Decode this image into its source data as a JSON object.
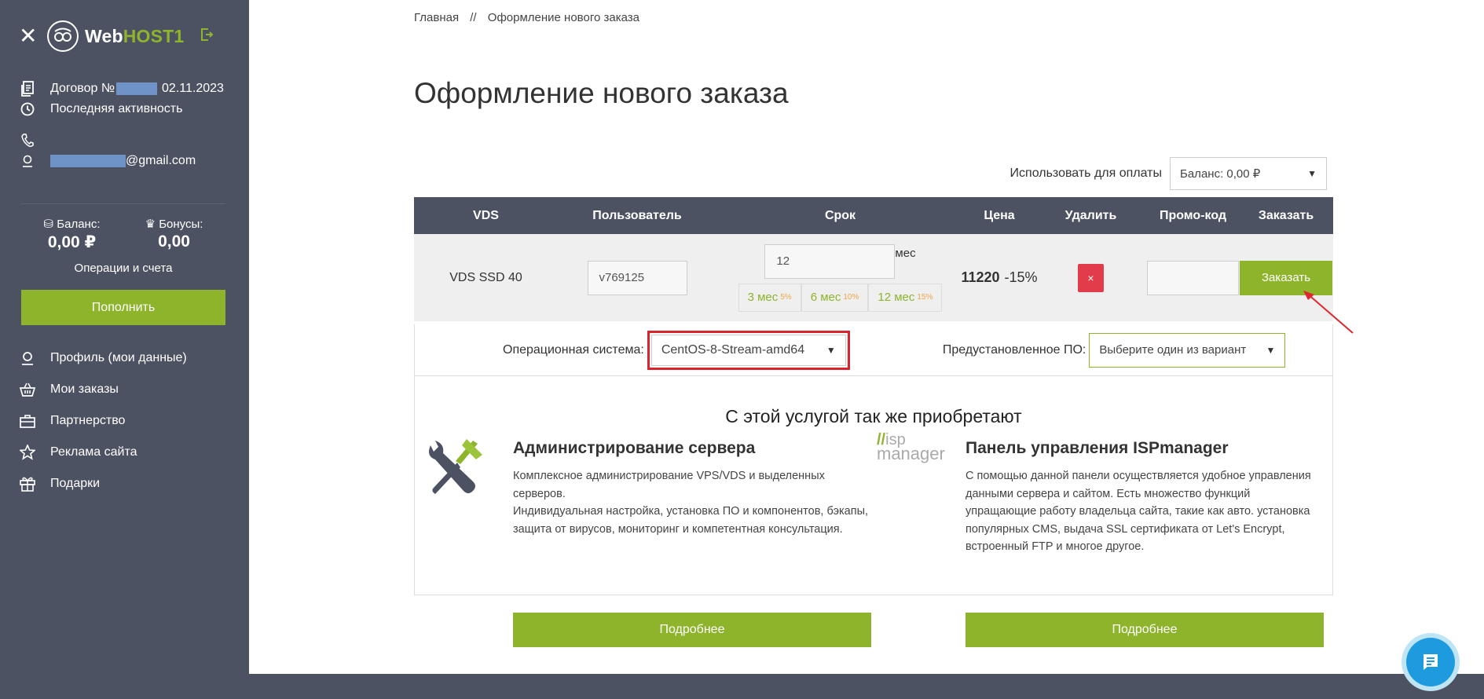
{
  "sidebar": {
    "logo_web": "Web",
    "logo_host": "HOST1",
    "contract_prefix": "Договор №",
    "contract_date": "02.11.2023",
    "last_activity": "Последняя активность",
    "email_suffix": "@gmail.com",
    "balance_label": "Баланс:",
    "balance_value": "0,00 ₽",
    "bonus_label": "Бонусы:",
    "bonus_value": "0,00",
    "operations_link": "Операции и счета",
    "topup_button": "Пополнить",
    "menu": [
      {
        "label": "Профиль (мои данные)",
        "icon": "user-icon"
      },
      {
        "label": "Мои заказы",
        "icon": "basket-icon"
      },
      {
        "label": "Партнерство",
        "icon": "briefcase-icon"
      },
      {
        "label": "Реклама сайта",
        "icon": "star-icon"
      },
      {
        "label": "Подарки",
        "icon": "gift-icon"
      }
    ]
  },
  "breadcrumb": {
    "home": "Главная",
    "separator": "//",
    "current": "Оформление нового заказа"
  },
  "page_title": "Оформление нового заказа",
  "payment": {
    "label": "Использовать для оплаты",
    "selected": "Баланс: 0,00 ₽"
  },
  "table": {
    "headers": [
      "VDS",
      "Пользователь",
      "Срок",
      "Цена",
      "Удалить",
      "Промо-код",
      "Заказать"
    ],
    "row": {
      "vds": "VDS SSD 40",
      "user": "v769125",
      "term_value": "12",
      "term_unit": "мес",
      "presets": [
        {
          "label": "3 мес",
          "discount": "5%"
        },
        {
          "label": "6 мес",
          "discount": "10%"
        },
        {
          "label": "12 мес",
          "discount": "15%"
        }
      ],
      "price": "11220",
      "discount": "-15%",
      "delete_symbol": "×",
      "promo": "",
      "order_button": "Заказать"
    }
  },
  "os": {
    "label": "Операционная система:",
    "selected": "CentOS-8-Stream-amd64",
    "software_label": "Предустановленное ПО:",
    "software_selected": "Выберите один из вариант"
  },
  "upsell": {
    "title": "С этой услугой так же приобретают",
    "cards": [
      {
        "title": "Администрирование сервера",
        "text1": "Комплексное администрирование VPS/VDS и выделенных серверов.",
        "text2": "Индивидуальная настройка, установка ПО и компонентов, бэкапы, защита от вирусов, мониторинг и компетентная консультация.",
        "button": "Подробнее"
      },
      {
        "title": "Панель управления ISPmanager",
        "text1": "С помощью данной панели осуществляется удобное управления данными сервера и сайтом. Есть множество функций упращающие работу владельца сайта, такие как авто. установка популярных CMS, выдача SSL сертификата от Let's Encrypt, встроенный FTP и многое другое.",
        "button": "Подробнее"
      }
    ],
    "isp_logo_top": "isp",
    "isp_logo_bottom": "manager"
  },
  "colors": {
    "accent": "#8db42b",
    "sidebar": "#4d5263",
    "danger": "#e23b4a",
    "chat": "#1e9bde"
  }
}
